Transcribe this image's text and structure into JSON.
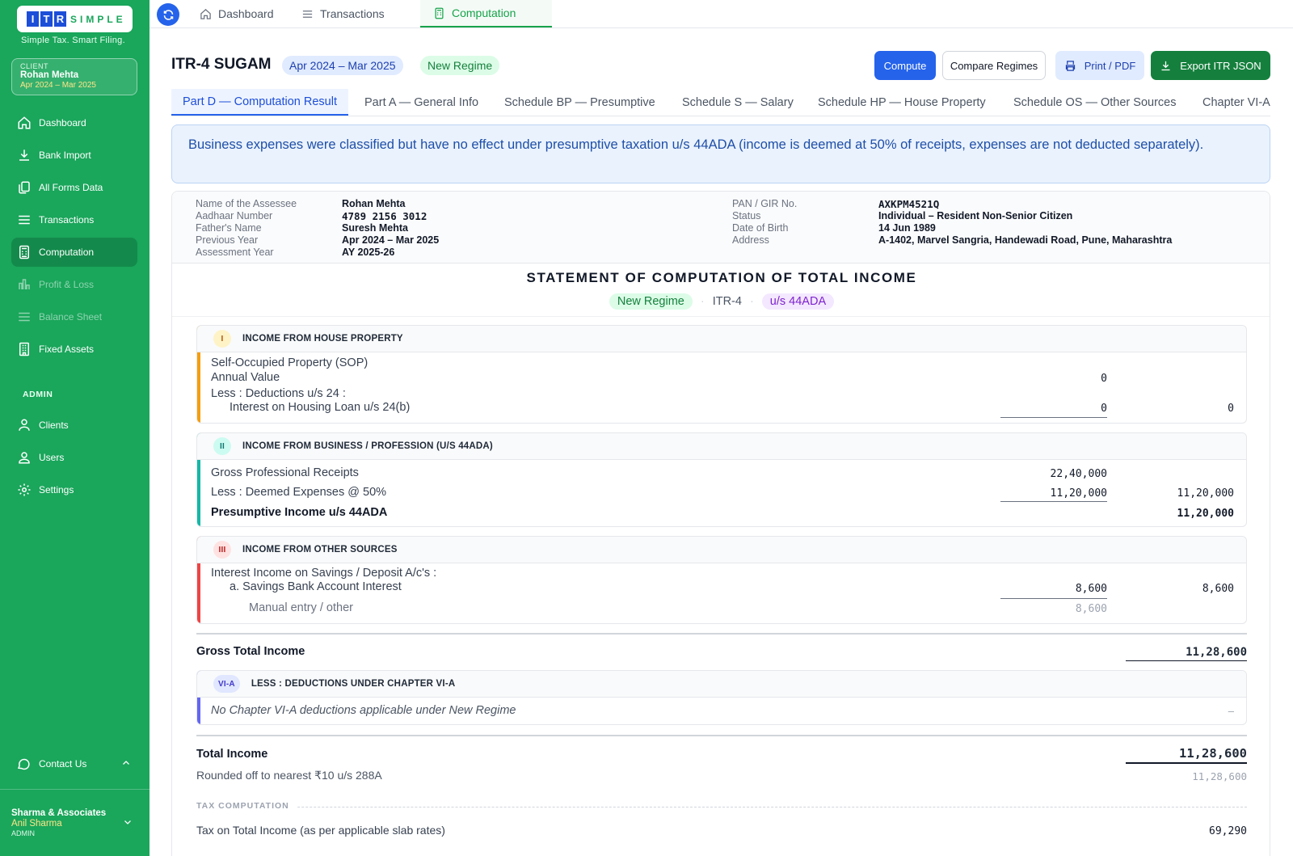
{
  "brand": {
    "logo_letters": [
      "I",
      "T",
      "R"
    ],
    "logo_word": "SIMPLE",
    "tagline": "Simple Tax. Smart Filing."
  },
  "client": {
    "label": "CLIENT",
    "name": "Rohan Mehta",
    "period": "Apr 2024 – Mar 2025"
  },
  "sidebar": {
    "items": [
      {
        "label": "Dashboard",
        "icon": "home-icon"
      },
      {
        "label": "Bank Import",
        "icon": "download-icon"
      },
      {
        "label": "All Forms Data",
        "icon": "copy-icon"
      },
      {
        "label": "Transactions",
        "icon": "list-icon"
      },
      {
        "label": "Computation",
        "icon": "calculator-icon",
        "active": true
      },
      {
        "label": "Profit & Loss",
        "icon": "bar-chart-icon",
        "disabled": true
      },
      {
        "label": "Balance Sheet",
        "icon": "list-icon",
        "disabled": true
      },
      {
        "label": "Fixed Assets",
        "icon": "building-icon"
      }
    ],
    "admin_label": "ADMIN",
    "admin_items": [
      {
        "label": "Clients",
        "icon": "user-tie-icon"
      },
      {
        "label": "Users",
        "icon": "users-icon"
      },
      {
        "label": "Settings",
        "icon": "gear-icon"
      }
    ],
    "contact_label": "Contact Us",
    "firm": {
      "name": "Sharma & Associates",
      "user": "Anil Sharma",
      "role": "ADMIN"
    }
  },
  "topbar": {
    "tabs": [
      {
        "label": "Dashboard"
      },
      {
        "label": "Transactions"
      },
      {
        "label": "Computation",
        "active": true
      }
    ]
  },
  "header": {
    "title": "ITR-4 SUGAM",
    "period_pill": "Apr 2024 – Mar 2025",
    "regime_pill": "New Regime",
    "buttons": {
      "compute": "Compute",
      "compare": "Compare Regimes",
      "print": "Print / PDF",
      "export": "Export ITR JSON"
    }
  },
  "subtabs": [
    "Part D — Computation Result",
    "Part A — General Info",
    "Schedule BP — Presumptive",
    "Schedule S — Salary",
    "Schedule HP — House Property",
    "Schedule OS — Other Sources",
    "Chapter VI-A"
  ],
  "notice": "Business expenses were classified but have no effect under presumptive taxation u/s 44ADA (income is deemed at 50% of receipts, expenses are not deducted separately).",
  "assessee": {
    "left": [
      {
        "k": "Name of the Assessee",
        "v": "Rohan Mehta"
      },
      {
        "k": "Aadhaar Number",
        "v": "4789 2156 3012"
      },
      {
        "k": "Father's Name",
        "v": "Suresh Mehta"
      },
      {
        "k": "Previous Year",
        "v": "Apr 2024 – Mar 2025"
      },
      {
        "k": "Assessment Year",
        "v": "AY 2025-26"
      }
    ],
    "right": [
      {
        "k": "PAN / GIR No.",
        "v": "AXKPM4521Q"
      },
      {
        "k": "Status",
        "v": "Individual – Resident Non-Senior Citizen"
      },
      {
        "k": "Date of Birth",
        "v": "14 Jun 1989"
      },
      {
        "k": "Address",
        "v": "A-1402, Marvel Sangria, Handewadi Road, Pune, Maharashtra"
      }
    ]
  },
  "statement": {
    "title": "STATEMENT OF COMPUTATION OF TOTAL INCOME",
    "tags": {
      "regime": "New Regime",
      "form": "ITR-4",
      "section": "u/s 44ADA",
      "separator": "·"
    },
    "house_property": {
      "num": "I",
      "heading": "INCOME FROM HOUSE PROPERTY",
      "color": "#f59e0b",
      "sop": "Self-Occupied Property (SOP)",
      "annual_value_label": "Annual Value",
      "annual_value": "0",
      "deductions_label": "Less : Deductions u/s 24 :",
      "interest_label": "Interest on Housing Loan u/s 24(b)",
      "interest": "0",
      "total": "0"
    },
    "business": {
      "num": "II",
      "heading": "INCOME FROM BUSINESS / PROFESSION (U/S 44ADA)",
      "color": "#14b8a6",
      "receipts_label": "Gross Professional Receipts",
      "receipts": "22,40,000",
      "deemed_label": "Less : Deemed Expenses @ 50%",
      "deemed": "11,20,000",
      "deemed_total": "11,20,000",
      "presumptive_label": "Presumptive Income u/s 44ADA",
      "presumptive": "11,20,000"
    },
    "other_sources": {
      "num": "III",
      "heading": "INCOME FROM OTHER SOURCES",
      "color": "#ef4444",
      "interest_heading": "Interest Income on Savings / Deposit A/c's :",
      "savings_label": "a. Savings Bank Account Interest",
      "savings": "8,600",
      "savings_total": "8,600",
      "manual_label": "Manual entry / other",
      "manual": "8,600"
    },
    "gross_total_label": "Gross Total Income",
    "gross_total": "11,28,600",
    "chapter_via": {
      "num": "VI-A",
      "heading": "LESS : DEDUCTIONS UNDER CHAPTER VI-A",
      "color": "#6366f1",
      "note": "No Chapter VI-A deductions applicable under New Regime",
      "value": "–"
    },
    "total_income_label": "Total Income",
    "total_income": "11,28,600",
    "rounded_label": "Rounded off to nearest ₹10 u/s 288A",
    "rounded": "11,28,600",
    "tax_section_label": "TAX COMPUTATION",
    "tax_label": "Tax on Total Income (as per applicable slab rates)",
    "tax": "69,290"
  },
  "colors": {
    "sidebar": "#1aa65b",
    "primary": "#2563eb",
    "accent_green": "#15803d"
  }
}
